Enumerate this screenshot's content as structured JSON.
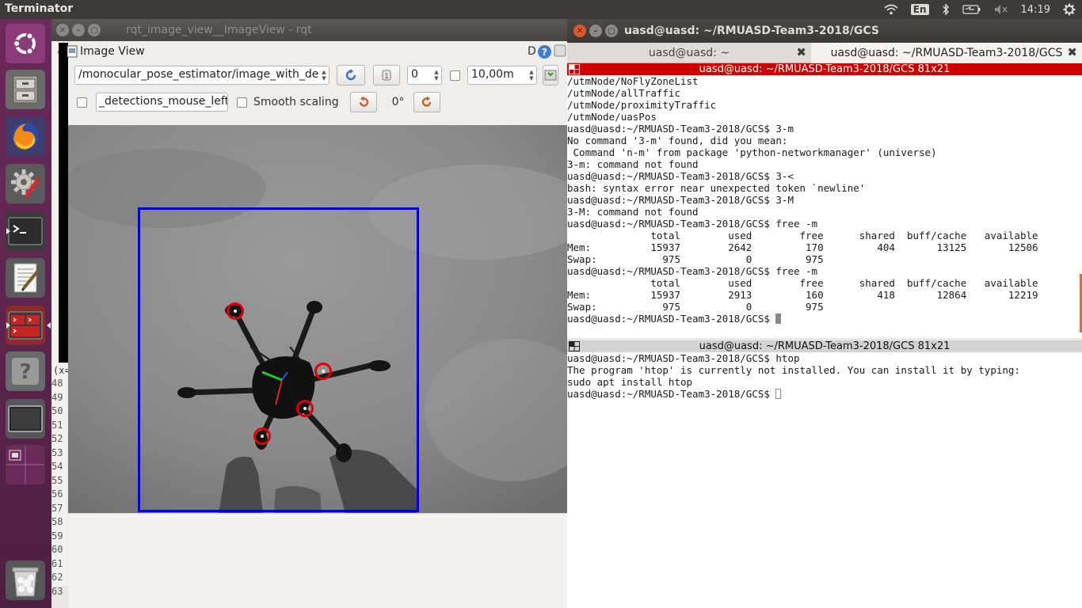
{
  "topbar": {
    "app_name": "Terminator",
    "lang": "En",
    "clock": "14:19"
  },
  "launcher": {
    "items": [
      "ubuntu-logo",
      "files",
      "firefox",
      "system-settings",
      "terminal",
      "text-editor",
      "terminator",
      "help",
      "workspace",
      "workspace-switcher",
      "trash"
    ]
  },
  "rqt": {
    "window_title": "rqt_image_view__ImageView - rqt",
    "plugin_title": "Image View",
    "d_label": "D",
    "help_label": "?",
    "topic": "/monocular_pose_estimator/image_with_de",
    "spin_value": "0",
    "max_value": "10,00m",
    "mouse_topic": "_detections_mouse_left",
    "smooth_scaling": "Smooth scaling",
    "rotation": "0°",
    "coord_label": "(x=",
    "line_numbers": [
      "48",
      "49",
      "50",
      "51",
      "52",
      "53",
      "54",
      "55",
      "56",
      "57",
      "58",
      "59",
      "60",
      "61",
      "62",
      "63"
    ]
  },
  "terminal": {
    "window_title": "uasd@uasd: ~/RMUASD-Team3-2018/GCS",
    "tabs": [
      {
        "label": "uasd@uasd: ~",
        "active": false
      },
      {
        "label": "uasd@uasd: ~/RMUASD-Team3-2018/GCS",
        "active": true
      }
    ],
    "pane1_title": "uasd@uasd: ~/RMUASD-Team3-2018/GCS 81x21",
    "pane1_lines": [
      "/utmNode/NoFlyZoneList",
      "/utmNode/allTraffic",
      "/utmNode/proximityTraffic",
      "/utmNode/uasPos",
      "uasd@uasd:~/RMUASD-Team3-2018/GCS$ 3-m",
      "No command '3-m' found, did you mean:",
      " Command 'n-m' from package 'python-networkmanager' (universe)",
      "3-m: command not found",
      "uasd@uasd:~/RMUASD-Team3-2018/GCS$ 3-<",
      "bash: syntax error near unexpected token `newline'",
      "uasd@uasd:~/RMUASD-Team3-2018/GCS$ 3-M",
      "3-M: command not found",
      "uasd@uasd:~/RMUASD-Team3-2018/GCS$ free -m",
      "              total        used        free      shared  buff/cache   available",
      "Mem:          15937        2642         170         404       13125       12506",
      "Swap:           975           0         975",
      "uasd@uasd:~/RMUASD-Team3-2018/GCS$ free -m",
      "              total        used        free      shared  buff/cache   available",
      "Mem:          15937        2913         160         418       12864       12219",
      "Swap:           975           0         975"
    ],
    "pane1_prompt": "uasd@uasd:~/RMUASD-Team3-2018/GCS$ ",
    "pane2_title": "uasd@uasd: ~/RMUASD-Team3-2018/GCS 81x21",
    "pane2_lines": [
      "uasd@uasd:~/RMUASD-Team3-2018/GCS$ htop",
      "The program 'htop' is currently not installed. You can install it by typing:",
      "sudo apt install htop"
    ],
    "pane2_prompt": "uasd@uasd:~/RMUASD-Team3-2018/GCS$ "
  },
  "colors": {
    "active_pane": "#cc0000",
    "launcher_bg": "#5e2750",
    "bbox": "#0000cc",
    "marker": "#dd0000"
  }
}
